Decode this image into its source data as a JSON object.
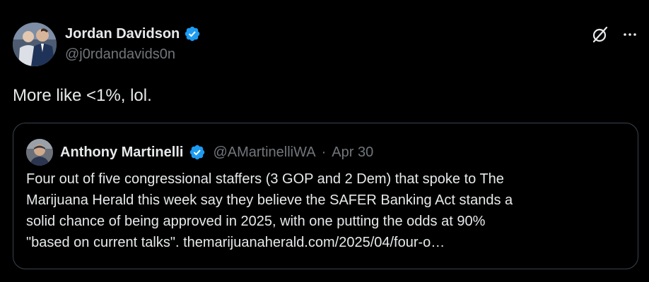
{
  "tweet": {
    "author": {
      "name": "Jordan Davidson",
      "handle": "@j0rdandavids0n",
      "verified": true
    },
    "text": "More like <1%, lol.",
    "actions": {
      "grok_icon": "grok-icon",
      "more_icon": "more-icon"
    }
  },
  "quote": {
    "author": {
      "name": "Anthony Martinelli",
      "handle": "@AMartinelliWA",
      "separator": "·",
      "date": "Apr 30",
      "verified": true
    },
    "lines": [
      "Four out of five congressional staffers (3 GOP and 2 Dem) that spoke to The",
      "Marijuana Herald this week say they believe the SAFER Banking Act stands a",
      "solid chance of being approved in 2025, with one putting the odds at 90%",
      "\"based on current talks\".  themarijuanaherald.com/2025/04/four-o…"
    ]
  },
  "colors": {
    "background": "#000000",
    "text_primary": "#e7e9ea",
    "text_secondary": "#71767b",
    "verified_blue": "#1d9bf0",
    "border": "#38444d"
  }
}
